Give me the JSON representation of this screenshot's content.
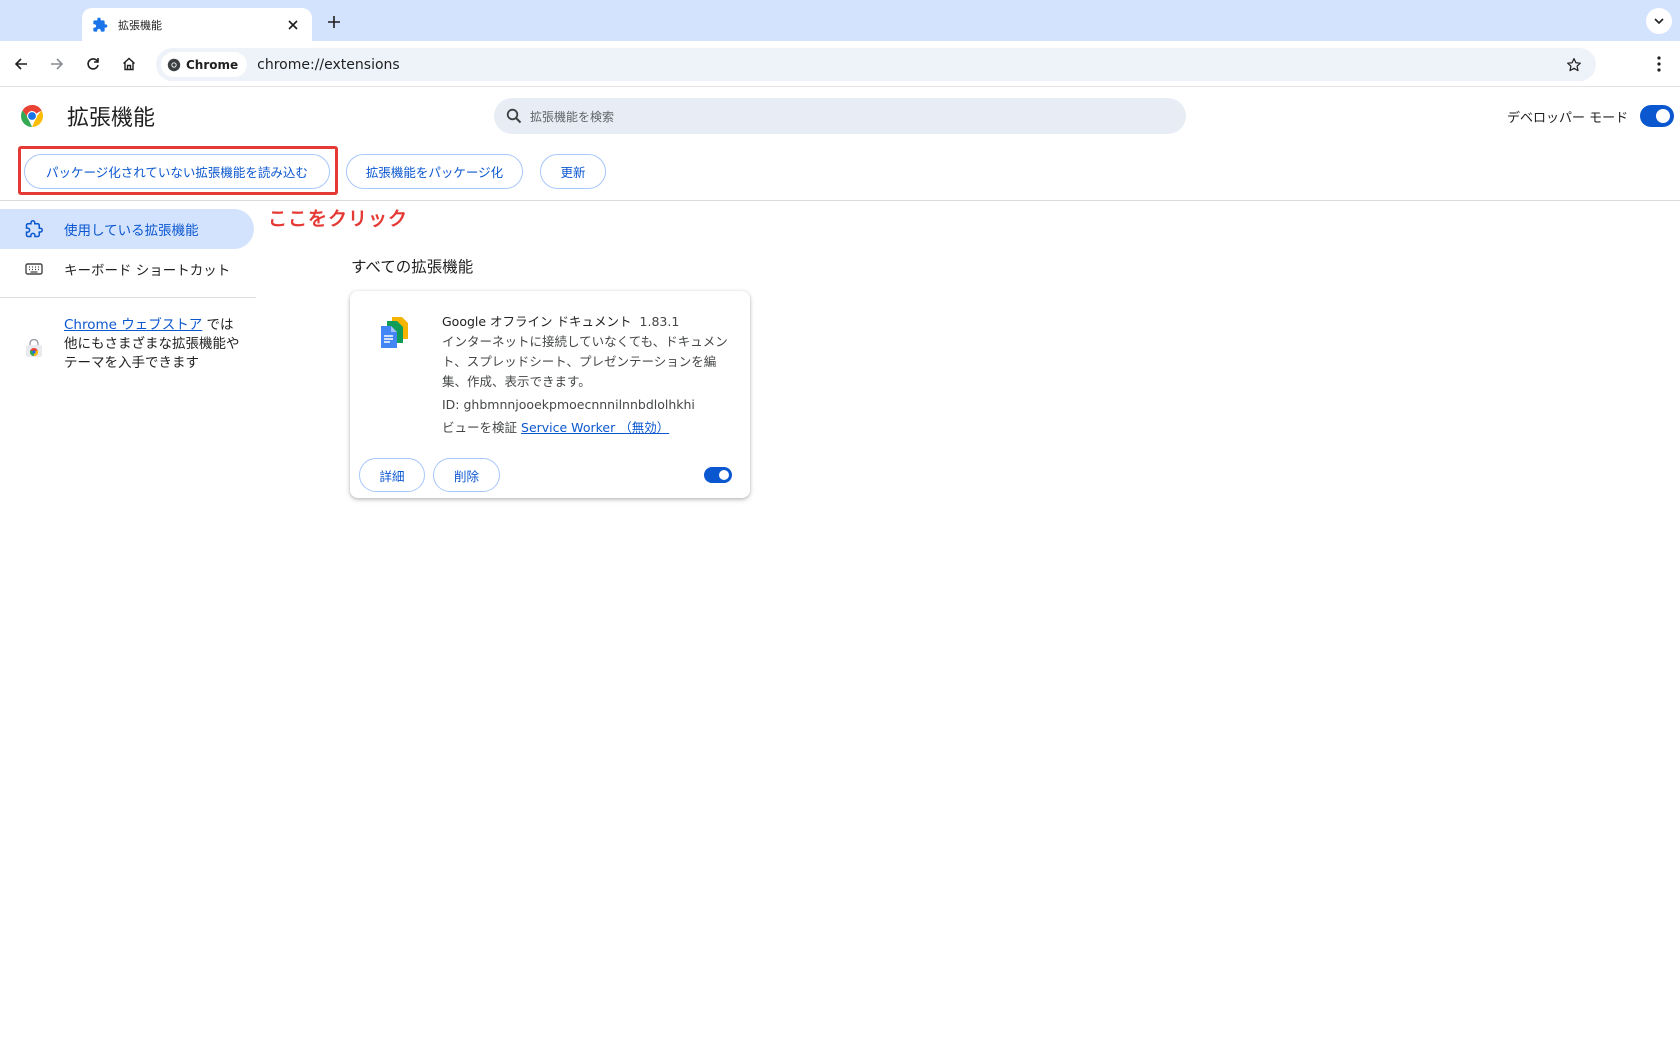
{
  "browser": {
    "tab_title": "拡張機能",
    "chip_label": "Chrome",
    "url": "chrome://extensions"
  },
  "header": {
    "title": "拡張機能",
    "search_placeholder": "拡張機能を検索",
    "developer_mode_label": "デベロッパー モード",
    "developer_mode_on": true
  },
  "actions": {
    "load_unpacked": "パッケージ化されていない拡張機能を読み込む",
    "pack_extension": "拡張機能をパッケージ化",
    "update": "更新"
  },
  "annotation": {
    "callout": "ここをクリック",
    "highlight_color": "#e53935"
  },
  "sidebar": {
    "items": [
      {
        "label": "使用している拡張機能",
        "icon": "extension-icon",
        "active": true
      },
      {
        "label": "キーボード ショートカット",
        "icon": "keyboard-icon",
        "active": false
      }
    ],
    "store_link": "Chrome ウェブストア",
    "store_text": " では他にもさまざまな拡張機能やテーマを入手できます"
  },
  "main": {
    "section_title": "すべての拡張機能",
    "extensions": [
      {
        "name": "Google オフライン ドキュメント",
        "version": "1.83.1",
        "description": "インターネットに接続していなくても、ドキュメント、スプレッドシート、プレゼンテーションを編集、作成、表示できます。",
        "id": "ID: ghbmnnjooekpmoecnnnilnnbdlolhkhi",
        "inspect_label": "ビューを検証",
        "inspect_link": "Service Worker （無効）",
        "details_button": "詳細",
        "remove_button": "削除",
        "enabled": true
      }
    ]
  },
  "colors": {
    "accent": "#0b57d0",
    "tabstrip": "#d3e3fd",
    "annotation": "#e53935"
  }
}
